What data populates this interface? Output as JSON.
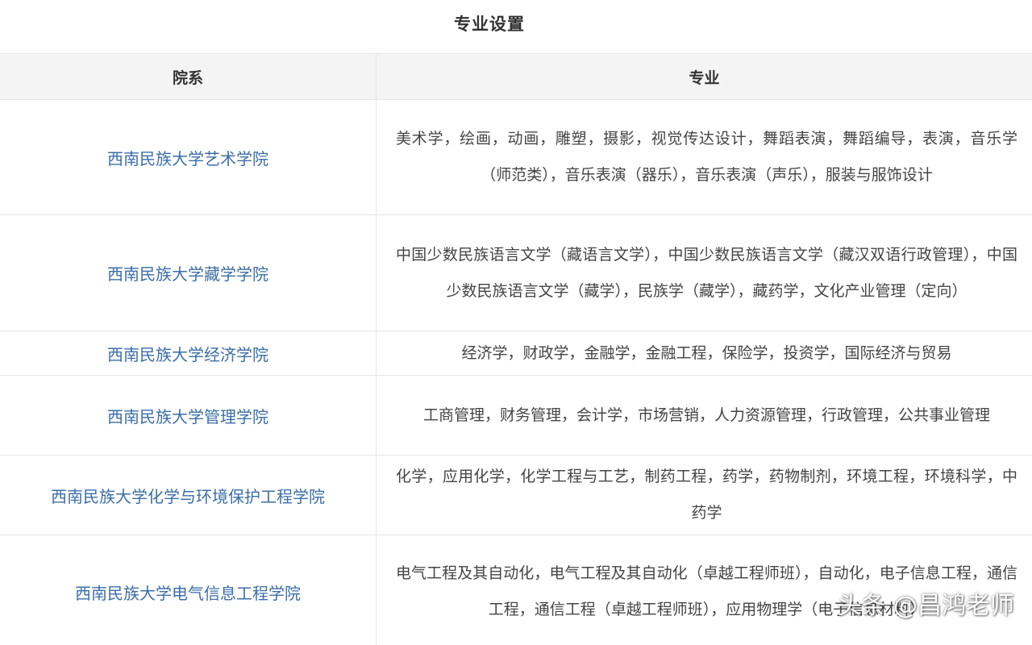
{
  "title": "专业设置",
  "table": {
    "headers": {
      "department": "院系",
      "majors": "专业"
    },
    "rows": [
      {
        "department": "西南民族大学艺术学院",
        "majors": "美术学，绘画，动画，雕塑，摄影，视觉传达设计，舞蹈表演，舞蹈编导，表演，音乐学（师范类），音乐表演（器乐），音乐表演（声乐），服装与服饰设计"
      },
      {
        "department": "西南民族大学藏学学院",
        "majors": "中国少数民族语言文学（藏语言文学），中国少数民族语言文学（藏汉双语行政管理），中国少数民族语言文学（藏学），民族学（藏学），藏药学，文化产业管理（定向）"
      },
      {
        "department": "西南民族大学经济学院",
        "majors": "经济学，财政学，金融学，金融工程，保险学，投资学，国际经济与贸易"
      },
      {
        "department": "西南民族大学管理学院",
        "majors": "工商管理，财务管理，会计学，市场营销，人力资源管理，行政管理，公共事业管理"
      },
      {
        "department": "西南民族大学化学与环境保护工程学院",
        "majors": "化学，应用化学，化学工程与工艺，制药工程，药学，药物制剂，环境工程，环境科学，中药学"
      },
      {
        "department": "西南民族大学电气信息工程学院",
        "majors": "电气工程及其自动化，电气工程及其自动化（卓越工程师班），自动化，电子信息工程，通信工程，通信工程（卓越工程师班），应用物理学（电子信息材料）"
      }
    ]
  },
  "watermark": "头条 @昌鸿老师"
}
